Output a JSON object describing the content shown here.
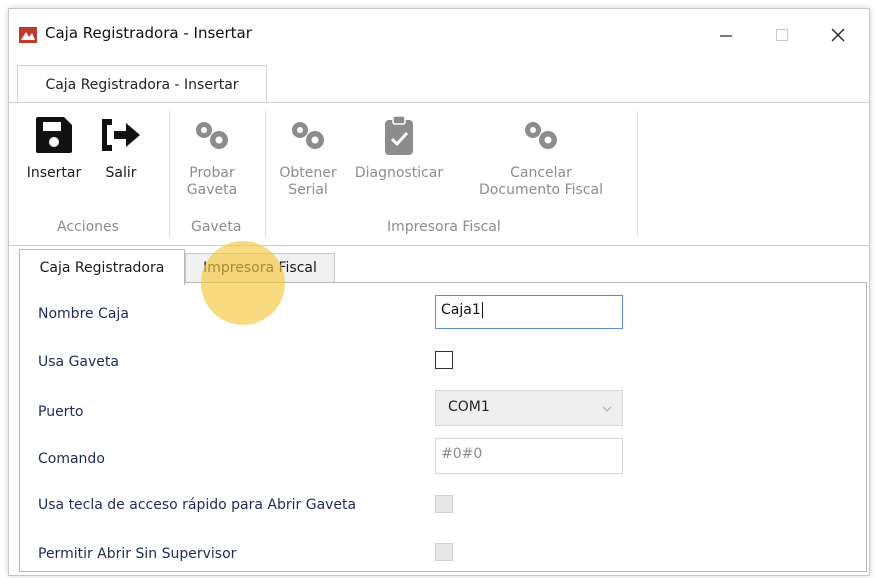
{
  "window": {
    "title": "Caja Registradora - Insertar",
    "controls": {
      "minimize": "—",
      "maximize": "☐",
      "close": "✕"
    }
  },
  "ribbon": {
    "tab_label": "Caja Registradora - Insertar",
    "buttons": [
      {
        "line1": "Insertar",
        "line2": "",
        "icon": "save-icon",
        "enabled": true
      },
      {
        "line1": "Salir",
        "line2": "",
        "icon": "exit-icon",
        "enabled": true
      },
      {
        "line1": "Probar",
        "line2": "Gaveta",
        "icon": "gears-icon",
        "enabled": false
      },
      {
        "line1": "Obtener",
        "line2": "Serial",
        "icon": "gears-icon",
        "enabled": false
      },
      {
        "line1": "Diagnosticar",
        "line2": "",
        "icon": "clipboard-check-icon",
        "enabled": false
      },
      {
        "line1": "Cancelar",
        "line2": "Documento Fiscal",
        "icon": "gears-icon",
        "enabled": false
      }
    ],
    "groups": [
      "Acciones",
      "Gaveta",
      "Impresora Fiscal"
    ]
  },
  "tabs": [
    {
      "label": "Caja Registradora",
      "active": true
    },
    {
      "label": "Impresora Fiscal",
      "active": false
    }
  ],
  "form": {
    "nombre_caja": {
      "label": "Nombre Caja",
      "value": "Caja1"
    },
    "usa_gaveta": {
      "label": "Usa Gaveta",
      "checked": false
    },
    "puerto": {
      "label": "Puerto",
      "value": "COM1"
    },
    "comando": {
      "label": "Comando",
      "value": "#0#0"
    },
    "usa_tecla": {
      "label": "Usa tecla de acceso rápido para Abrir Gaveta",
      "checked": false
    },
    "permitir": {
      "label": "Permitir Abrir Sin Supervisor",
      "checked": false
    }
  },
  "colors": {
    "label_text": "#1e2a5a",
    "disabled_text": "#8c8c8c",
    "input_focus_border": "#5b8fc7",
    "cursor_highlight": "#f5c83c"
  }
}
